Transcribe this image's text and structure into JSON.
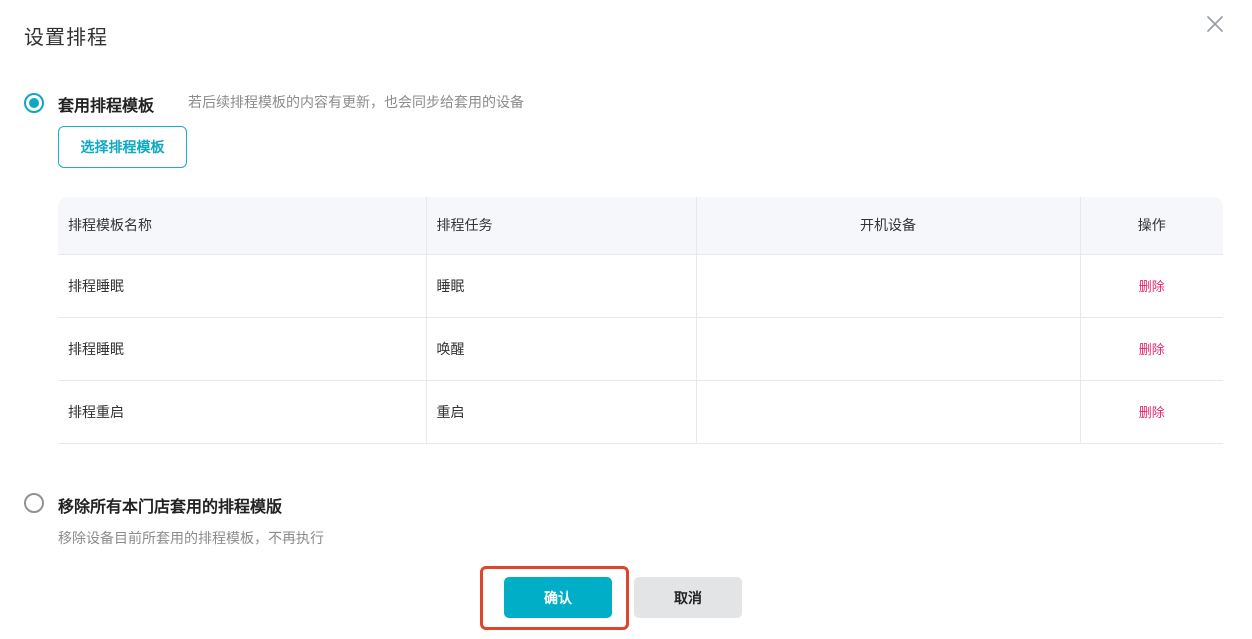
{
  "dialog": {
    "title": "设置排程"
  },
  "option_apply": {
    "label": "套用排程模板",
    "hint": "若后续排程模板的内容有更新，也会同步给套用的设备",
    "selected": true,
    "button_label": "选择排程模板"
  },
  "table": {
    "headers": [
      "排程模板名称",
      "排程任务",
      "开机设备",
      "操作"
    ],
    "rows": [
      {
        "name": "排程睡眠",
        "task": "睡眠",
        "device": "",
        "action": "删除"
      },
      {
        "name": "排程睡眠",
        "task": "唤醒",
        "device": "",
        "action": "删除"
      },
      {
        "name": "排程重启",
        "task": "重启",
        "device": "",
        "action": "删除"
      }
    ]
  },
  "option_remove": {
    "label": "移除所有本门店套用的排程模版",
    "hint": "移除设备目前所套用的排程模板，不再执行",
    "selected": false
  },
  "footer": {
    "confirm_label": "确认",
    "cancel_label": "取消"
  },
  "colors": {
    "accent": "#00aec7",
    "danger": "#e5266e",
    "highlight": "#e0452b"
  }
}
